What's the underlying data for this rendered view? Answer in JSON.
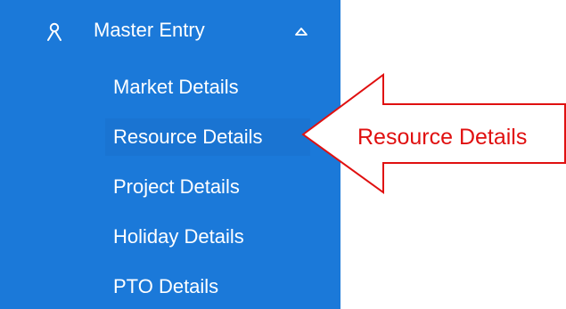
{
  "menu": {
    "header_label": "Master Entry",
    "header_icon": "person-icon",
    "collapse_icon": "chevron-up-icon",
    "items": [
      {
        "label": "Market Details"
      },
      {
        "label": "Resource Details"
      },
      {
        "label": "Project Details"
      },
      {
        "label": "Holiday Details"
      },
      {
        "label": "PTO Details"
      }
    ],
    "colors": {
      "sidebar_bg": "#1b79d9",
      "text": "#ffffff"
    }
  },
  "annotation": {
    "label": "Resource Details",
    "color": "#e01010"
  }
}
